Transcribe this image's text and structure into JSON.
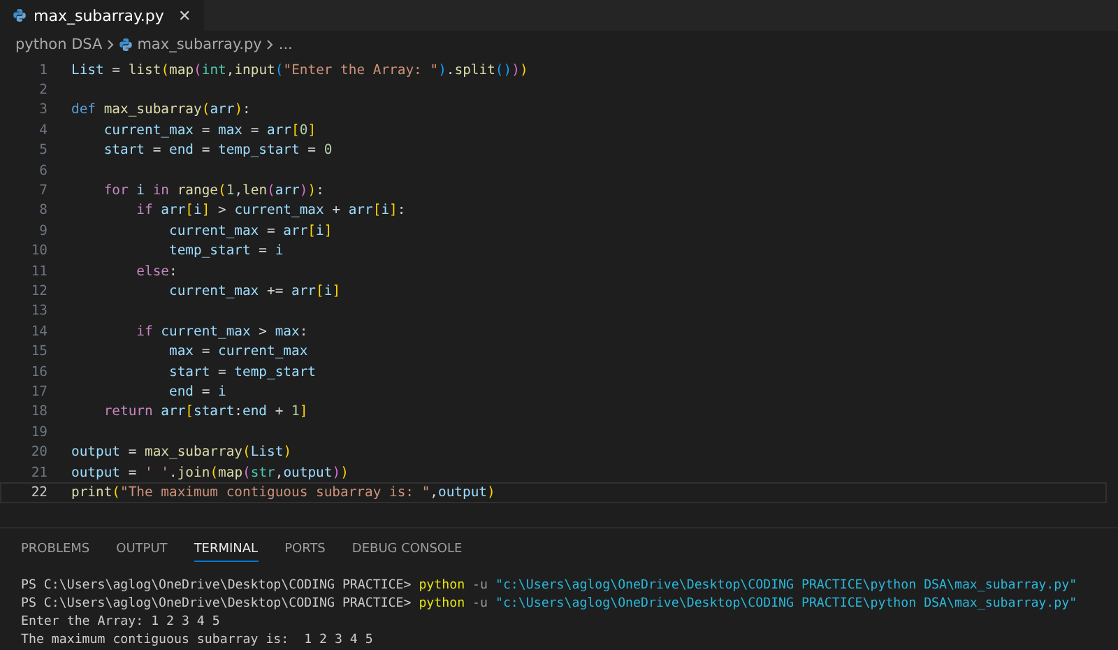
{
  "editor_tabs": [
    {
      "label": "max_subarray.py",
      "selected": true,
      "close": "✕"
    }
  ],
  "breadcrumb": {
    "folder": "python DSA",
    "file": "max_subarray.py",
    "more": "..."
  },
  "code_lines": [
    {
      "number": "1",
      "current": false,
      "tokens": [
        {
          "text": "List",
          "kind": "variable"
        },
        {
          "text": " = ",
          "kind": "plain"
        },
        {
          "text": "list",
          "kind": "function"
        },
        {
          "text": "(",
          "kind": "bracket1"
        },
        {
          "text": "map",
          "kind": "function"
        },
        {
          "text": "(",
          "kind": "bracket2"
        },
        {
          "text": "int",
          "kind": "type"
        },
        {
          "text": ",",
          "kind": "plain"
        },
        {
          "text": "input",
          "kind": "function"
        },
        {
          "text": "(",
          "kind": "bracket3"
        },
        {
          "text": "\"Enter the Array: \"",
          "kind": "string"
        },
        {
          "text": ")",
          "kind": "bracket3"
        },
        {
          "text": ".",
          "kind": "plain"
        },
        {
          "text": "split",
          "kind": "function"
        },
        {
          "text": "()",
          "kind": "bracket3"
        },
        {
          "text": ")",
          "kind": "bracket2"
        },
        {
          "text": ")",
          "kind": "bracket1"
        }
      ]
    },
    {
      "number": "2",
      "current": false
    },
    {
      "number": "3",
      "current": false,
      "tokens": [
        {
          "text": "def ",
          "kind": "storage"
        },
        {
          "text": "max_subarray",
          "kind": "function"
        },
        {
          "text": "(",
          "kind": "bracket1"
        },
        {
          "text": "arr",
          "kind": "variable"
        },
        {
          "text": ")",
          "kind": "bracket1"
        },
        {
          "text": ":",
          "kind": "plain"
        }
      ]
    },
    {
      "number": "4",
      "current": false,
      "tokens": [
        {
          "text": "    current_max",
          "kind": "variable"
        },
        {
          "text": " = ",
          "kind": "plain"
        },
        {
          "text": "max",
          "kind": "variable"
        },
        {
          "text": " = ",
          "kind": "plain"
        },
        {
          "text": "arr",
          "kind": "variable"
        },
        {
          "text": "[",
          "kind": "bracket1"
        },
        {
          "text": "0",
          "kind": "number"
        },
        {
          "text": "]",
          "kind": "bracket1"
        }
      ]
    },
    {
      "number": "5",
      "current": false,
      "tokens": [
        {
          "text": "    start",
          "kind": "variable"
        },
        {
          "text": " = ",
          "kind": "plain"
        },
        {
          "text": "end",
          "kind": "variable"
        },
        {
          "text": " = ",
          "kind": "plain"
        },
        {
          "text": "temp_start",
          "kind": "variable"
        },
        {
          "text": " = ",
          "kind": "plain"
        },
        {
          "text": "0",
          "kind": "number"
        }
      ]
    },
    {
      "number": "6",
      "current": false
    },
    {
      "number": "7",
      "current": false,
      "tokens": [
        {
          "text": "    for ",
          "kind": "keyword"
        },
        {
          "text": "i ",
          "kind": "variable"
        },
        {
          "text": "in ",
          "kind": "keyword"
        },
        {
          "text": "range",
          "kind": "function"
        },
        {
          "text": "(",
          "kind": "bracket1"
        },
        {
          "text": "1",
          "kind": "number"
        },
        {
          "text": ",",
          "kind": "plain"
        },
        {
          "text": "len",
          "kind": "function"
        },
        {
          "text": "(",
          "kind": "bracket2"
        },
        {
          "text": "arr",
          "kind": "variable"
        },
        {
          "text": ")",
          "kind": "bracket2"
        },
        {
          "text": ")",
          "kind": "bracket1"
        },
        {
          "text": ":",
          "kind": "plain"
        }
      ]
    },
    {
      "number": "8",
      "current": false,
      "tokens": [
        {
          "text": "        if ",
          "kind": "keyword"
        },
        {
          "text": "arr",
          "kind": "variable"
        },
        {
          "text": "[",
          "kind": "bracket1"
        },
        {
          "text": "i",
          "kind": "variable"
        },
        {
          "text": "]",
          "kind": "bracket1"
        },
        {
          "text": " > ",
          "kind": "plain"
        },
        {
          "text": "current_max",
          "kind": "variable"
        },
        {
          "text": " + ",
          "kind": "plain"
        },
        {
          "text": "arr",
          "kind": "variable"
        },
        {
          "text": "[",
          "kind": "bracket1"
        },
        {
          "text": "i",
          "kind": "variable"
        },
        {
          "text": "]",
          "kind": "bracket1"
        },
        {
          "text": ":",
          "kind": "plain"
        }
      ]
    },
    {
      "number": "9",
      "current": false,
      "tokens": [
        {
          "text": "            current_max",
          "kind": "variable"
        },
        {
          "text": " = ",
          "kind": "plain"
        },
        {
          "text": "arr",
          "kind": "variable"
        },
        {
          "text": "[",
          "kind": "bracket1"
        },
        {
          "text": "i",
          "kind": "variable"
        },
        {
          "text": "]",
          "kind": "bracket1"
        }
      ]
    },
    {
      "number": "10",
      "current": false,
      "tokens": [
        {
          "text": "            temp_start",
          "kind": "variable"
        },
        {
          "text": " = ",
          "kind": "plain"
        },
        {
          "text": "i",
          "kind": "variable"
        }
      ]
    },
    {
      "number": "11",
      "current": false,
      "tokens": [
        {
          "text": "        else",
          "kind": "keyword"
        },
        {
          "text": ":",
          "kind": "plain"
        }
      ]
    },
    {
      "number": "12",
      "current": false,
      "tokens": [
        {
          "text": "            current_max",
          "kind": "variable"
        },
        {
          "text": " += ",
          "kind": "plain"
        },
        {
          "text": "arr",
          "kind": "variable"
        },
        {
          "text": "[",
          "kind": "bracket1"
        },
        {
          "text": "i",
          "kind": "variable"
        },
        {
          "text": "]",
          "kind": "bracket1"
        }
      ]
    },
    {
      "number": "13",
      "current": false
    },
    {
      "number": "14",
      "current": false,
      "tokens": [
        {
          "text": "        if ",
          "kind": "keyword"
        },
        {
          "text": "current_max",
          "kind": "variable"
        },
        {
          "text": " > ",
          "kind": "plain"
        },
        {
          "text": "max",
          "kind": "variable"
        },
        {
          "text": ":",
          "kind": "plain"
        }
      ]
    },
    {
      "number": "15",
      "current": false,
      "tokens": [
        {
          "text": "            max",
          "kind": "variable"
        },
        {
          "text": " = ",
          "kind": "plain"
        },
        {
          "text": "current_max",
          "kind": "variable"
        }
      ]
    },
    {
      "number": "16",
      "current": false,
      "tokens": [
        {
          "text": "            start",
          "kind": "variable"
        },
        {
          "text": " = ",
          "kind": "plain"
        },
        {
          "text": "temp_start",
          "kind": "variable"
        }
      ]
    },
    {
      "number": "17",
      "current": false,
      "tokens": [
        {
          "text": "            end",
          "kind": "variable"
        },
        {
          "text": " = ",
          "kind": "plain"
        },
        {
          "text": "i",
          "kind": "variable"
        }
      ]
    },
    {
      "number": "18",
      "current": false,
      "tokens": [
        {
          "text": "    return ",
          "kind": "keyword"
        },
        {
          "text": "arr",
          "kind": "variable"
        },
        {
          "text": "[",
          "kind": "bracket1"
        },
        {
          "text": "start",
          "kind": "variable"
        },
        {
          "text": ":",
          "kind": "plain"
        },
        {
          "text": "end",
          "kind": "variable"
        },
        {
          "text": " + ",
          "kind": "plain"
        },
        {
          "text": "1",
          "kind": "number"
        },
        {
          "text": "]",
          "kind": "bracket1"
        }
      ]
    },
    {
      "number": "19",
      "current": false
    },
    {
      "number": "20",
      "current": false,
      "tokens": [
        {
          "text": "output",
          "kind": "variable"
        },
        {
          "text": " = ",
          "kind": "plain"
        },
        {
          "text": "max_subarray",
          "kind": "function"
        },
        {
          "text": "(",
          "kind": "bracket1"
        },
        {
          "text": "List",
          "kind": "variable"
        },
        {
          "text": ")",
          "kind": "bracket1"
        }
      ]
    },
    {
      "number": "21",
      "current": false,
      "tokens": [
        {
          "text": "output",
          "kind": "variable"
        },
        {
          "text": " = ",
          "kind": "plain"
        },
        {
          "text": "' '",
          "kind": "string"
        },
        {
          "text": ".",
          "kind": "plain"
        },
        {
          "text": "join",
          "kind": "function"
        },
        {
          "text": "(",
          "kind": "bracket1"
        },
        {
          "text": "map",
          "kind": "function"
        },
        {
          "text": "(",
          "kind": "bracket2"
        },
        {
          "text": "str",
          "kind": "type"
        },
        {
          "text": ",",
          "kind": "plain"
        },
        {
          "text": "output",
          "kind": "variable"
        },
        {
          "text": ")",
          "kind": "bracket2"
        },
        {
          "text": ")",
          "kind": "bracket1"
        }
      ]
    },
    {
      "number": "22",
      "current": true,
      "tokens": [
        {
          "text": "print",
          "kind": "function"
        },
        {
          "text": "(",
          "kind": "bracket1"
        },
        {
          "text": "\"The maximum contiguous subarray is: \"",
          "kind": "string"
        },
        {
          "text": ",",
          "kind": "plain"
        },
        {
          "text": "output",
          "kind": "variable"
        },
        {
          "text": ")",
          "kind": "bracket1"
        }
      ]
    }
  ],
  "panel_tabs": [
    {
      "label": "PROBLEMS",
      "selected": false
    },
    {
      "label": "OUTPUT",
      "selected": false
    },
    {
      "label": "TERMINAL",
      "selected": true
    },
    {
      "label": "PORTS",
      "selected": false
    },
    {
      "label": "DEBUG CONSOLE",
      "selected": false
    }
  ],
  "terminal_lines": [
    {
      "tokens": [
        {
          "text": "PS C:\\Users\\aglog\\OneDrive\\Desktop\\CODING PRACTICE> ",
          "kind": "plain"
        },
        {
          "text": "python",
          "kind": "command"
        },
        {
          "text": " -u ",
          "kind": "flag"
        },
        {
          "text": "\"c:\\Users\\aglog\\OneDrive\\Desktop\\CODING PRACTICE\\python DSA\\max_subarray.py\"",
          "kind": "path"
        }
      ]
    },
    {
      "tokens": [
        {
          "text": "PS C:\\Users\\aglog\\OneDrive\\Desktop\\CODING PRACTICE> ",
          "kind": "plain"
        },
        {
          "text": "python",
          "kind": "command"
        },
        {
          "text": " -u ",
          "kind": "flag"
        },
        {
          "text": "\"c:\\Users\\aglog\\OneDrive\\Desktop\\CODING PRACTICE\\python DSA\\max_subarray.py\"",
          "kind": "path"
        }
      ]
    },
    {
      "tokens": [
        {
          "text": "Enter the Array: 1 2 3 4 5",
          "kind": "plain"
        }
      ]
    },
    {
      "tokens": [
        {
          "text": "The maximum contiguous subarray is:  1 2 3 4 5",
          "kind": "plain"
        }
      ]
    }
  ]
}
